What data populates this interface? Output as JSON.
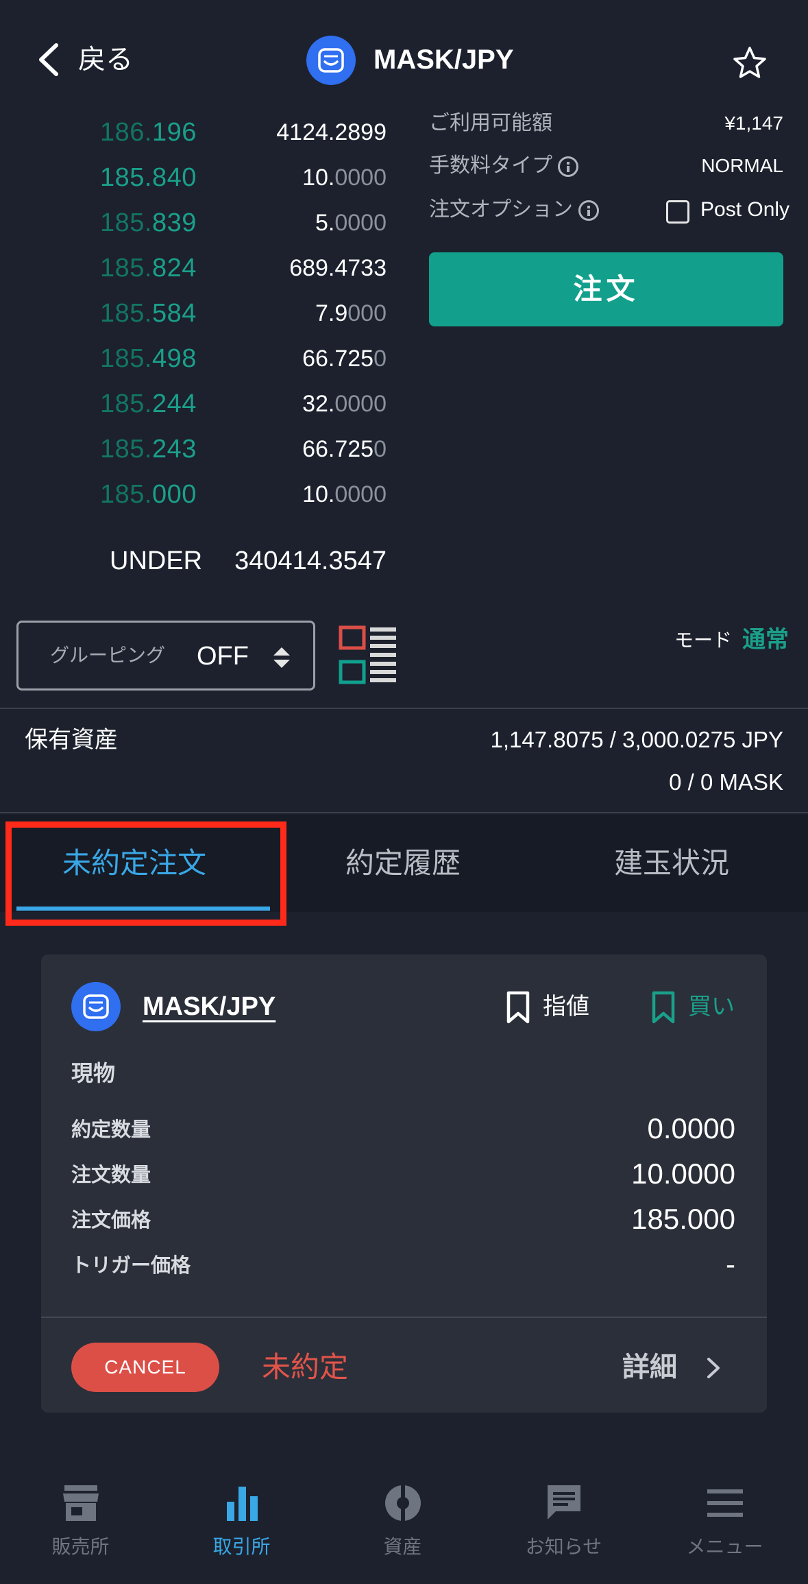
{
  "header": {
    "back_label": "戻る",
    "pair": "MASK/JPY",
    "icons": {
      "back": "chevron-left-icon",
      "coin": "mask-coin-icon",
      "favorite": "star-outline-icon"
    }
  },
  "orderbook": {
    "rows": [
      {
        "price_a": "186.",
        "price_b": "196",
        "qty_a": "4124.2899",
        "qty_b": ""
      },
      {
        "price_a": "185.840",
        "price_b": "",
        "qty_a": "10.",
        "qty_b": "0000"
      },
      {
        "price_a": "185.",
        "price_b": "839",
        "qty_a": "5.",
        "qty_b": "0000"
      },
      {
        "price_a": "185.",
        "price_b": "824",
        "qty_a": "689.4733",
        "qty_b": ""
      },
      {
        "price_a": "185.",
        "price_b": "584",
        "qty_a": "7.9",
        "qty_b": "000"
      },
      {
        "price_a": "185.",
        "price_b": "498",
        "qty_a": "66.725",
        "qty_b": "0"
      },
      {
        "price_a": "185.",
        "price_b": "244",
        "qty_a": "32.",
        "qty_b": "0000"
      },
      {
        "price_a": "185.",
        "price_b": "243",
        "qty_a": "66.725",
        "qty_b": "0"
      },
      {
        "price_a": "185.",
        "price_b": "000",
        "qty_a": "10.",
        "qty_b": "0000"
      }
    ],
    "under_label": "UNDER",
    "under_value": "340414.3547"
  },
  "order_panel": {
    "available_label": "ご利用可能額",
    "available_value": "¥1,147",
    "fee_type_label": "手数料タイプ",
    "fee_type_value": "NORMAL",
    "order_option_label": "注文オプション",
    "post_only_label": "Post Only",
    "post_only_checked": false,
    "order_button": "注文"
  },
  "controls": {
    "grouping_label": "グルーピング",
    "grouping_value": "OFF",
    "mode_label": "モード",
    "mode_value": "通常",
    "icons": {
      "sort": "sort-updown-icon",
      "layout": "orderbook-layout-icon"
    }
  },
  "holdings": {
    "label": "保有資産",
    "jpy": "1,147.8075 / 3,000.0275  JPY",
    "mask": "0 / 0  MASK"
  },
  "tabs": [
    {
      "label": "未約定注文",
      "active": true
    },
    {
      "label": "約定履歴",
      "active": false
    },
    {
      "label": "建玉状況",
      "active": false
    }
  ],
  "order_card": {
    "pair": "MASK/JPY",
    "order_type": "指値",
    "side": "買い",
    "section": "現物",
    "rows": [
      {
        "label": "約定数量",
        "value": "0.0000"
      },
      {
        "label": "注文数量",
        "value": "10.0000"
      },
      {
        "label": "注文価格",
        "value": "185.000"
      },
      {
        "label": "トリガー価格",
        "value": "-"
      }
    ],
    "cancel_button": "CANCEL",
    "status": "未約定",
    "detail_label": "詳細"
  },
  "bottom_nav": [
    {
      "label": "販売所",
      "icon": "store-icon",
      "active": false
    },
    {
      "label": "取引所",
      "icon": "bar-chart-icon",
      "active": true
    },
    {
      "label": "資産",
      "icon": "pie-chart-icon",
      "active": false
    },
    {
      "label": "お知らせ",
      "icon": "message-icon",
      "active": false
    },
    {
      "label": "メニュー",
      "icon": "menu-icon",
      "active": false
    }
  ],
  "colors": {
    "background": "#1c212d",
    "accent_green": "#1aa08a",
    "accent_blue": "#3aa7e6",
    "cancel_red": "#dc4f47",
    "highlight_red": "#ff2a1a"
  }
}
